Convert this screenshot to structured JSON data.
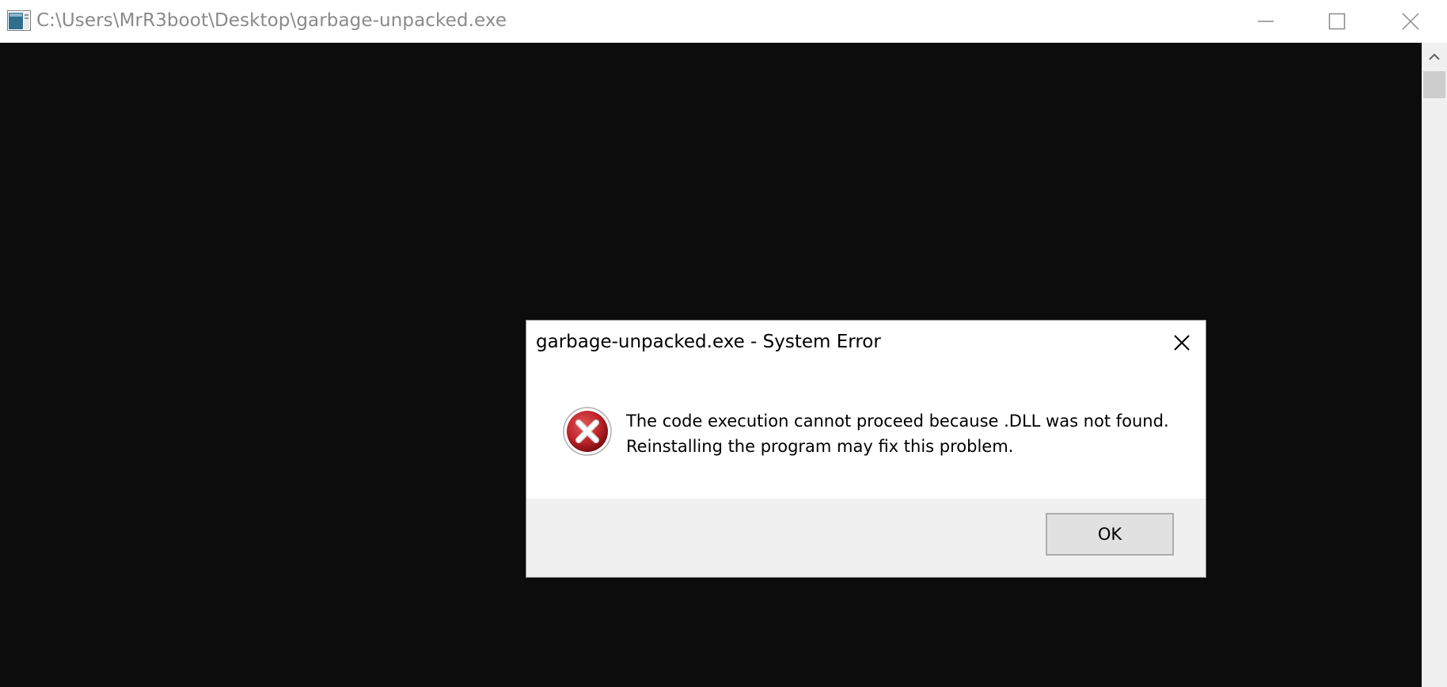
{
  "window": {
    "title": "C:\\Users\\MrR3boot\\Desktop\\garbage-unpacked.exe",
    "background_color": "#0c0c0c",
    "icons": {
      "app": "console-app-icon",
      "minimize": "minimize-icon",
      "maximize": "maximize-icon",
      "close": "close-icon",
      "scroll_up": "chevron-up-icon"
    }
  },
  "dialog": {
    "title": "garbage-unpacked.exe - System Error",
    "icon": "error-icon",
    "message_line1": "The code execution cannot proceed because .DLL was not found.",
    "message_line2": "Reinstalling the program may fix this problem.",
    "ok_label": "OK",
    "icon_color": "#c0262b"
  }
}
